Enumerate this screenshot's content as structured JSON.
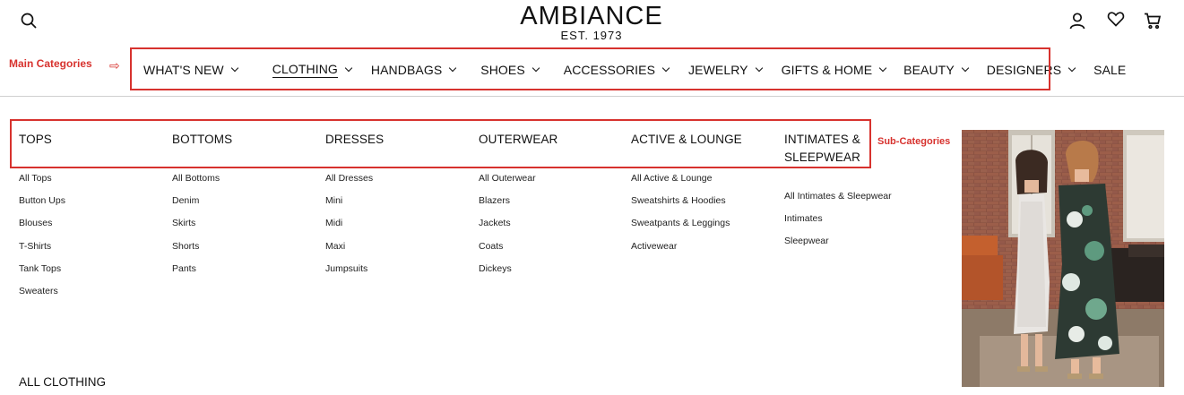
{
  "header": {
    "logo_name": "AMBIANCE",
    "logo_est": "EST. 1973",
    "icons": [
      "search-icon",
      "user-icon",
      "heart-icon",
      "cart-icon"
    ]
  },
  "main_nav": [
    {
      "label": "WHAT'S NEW",
      "has_chevron": true,
      "active": false
    },
    {
      "label": "CLOTHING",
      "has_chevron": true,
      "active": true
    },
    {
      "label": "HANDBAGS",
      "has_chevron": true,
      "active": false
    },
    {
      "label": "SHOES",
      "has_chevron": true,
      "active": false
    },
    {
      "label": "ACCESSORIES",
      "has_chevron": true,
      "active": false
    },
    {
      "label": "JEWELRY",
      "has_chevron": true,
      "active": false
    },
    {
      "label": "GIFTS & HOME",
      "has_chevron": true,
      "active": false
    },
    {
      "label": "BEAUTY",
      "has_chevron": true,
      "active": false
    },
    {
      "label": "DESIGNERS",
      "has_chevron": true,
      "active": false
    },
    {
      "label": "SALE",
      "has_chevron": false,
      "active": false
    }
  ],
  "annotations": {
    "main_label": "Main Categories",
    "sub_label": "Sub-Categories",
    "color": "#d7322e"
  },
  "columns": [
    {
      "heading": "TOPS",
      "links": [
        "All Tops",
        "Button Ups",
        "Blouses",
        "T-Shirts",
        "Tank Tops",
        "Sweaters"
      ]
    },
    {
      "heading": "BOTTOMS",
      "links": [
        "All Bottoms",
        "Denim",
        "Skirts",
        "Shorts",
        "Pants"
      ]
    },
    {
      "heading": "DRESSES",
      "links": [
        "All Dresses",
        "Mini",
        "Midi",
        "Maxi",
        "Jumpsuits"
      ]
    },
    {
      "heading": "OUTERWEAR",
      "links": [
        "All Outerwear",
        "Blazers",
        "Jackets",
        "Coats",
        "Dickeys"
      ]
    },
    {
      "heading": "ACTIVE & LOUNGE",
      "links": [
        "All Active & Lounge",
        "Sweatshirts & Hoodies",
        "Sweatpants & Leggings",
        "Activewear"
      ]
    },
    {
      "heading_lines": [
        "INTIMATES &",
        "SLEEPWEAR"
      ],
      "links": [
        "All Intimates & Sleepwear",
        "Intimates",
        "Sleepwear"
      ]
    }
  ],
  "all_clothing": "ALL CLOTHING"
}
